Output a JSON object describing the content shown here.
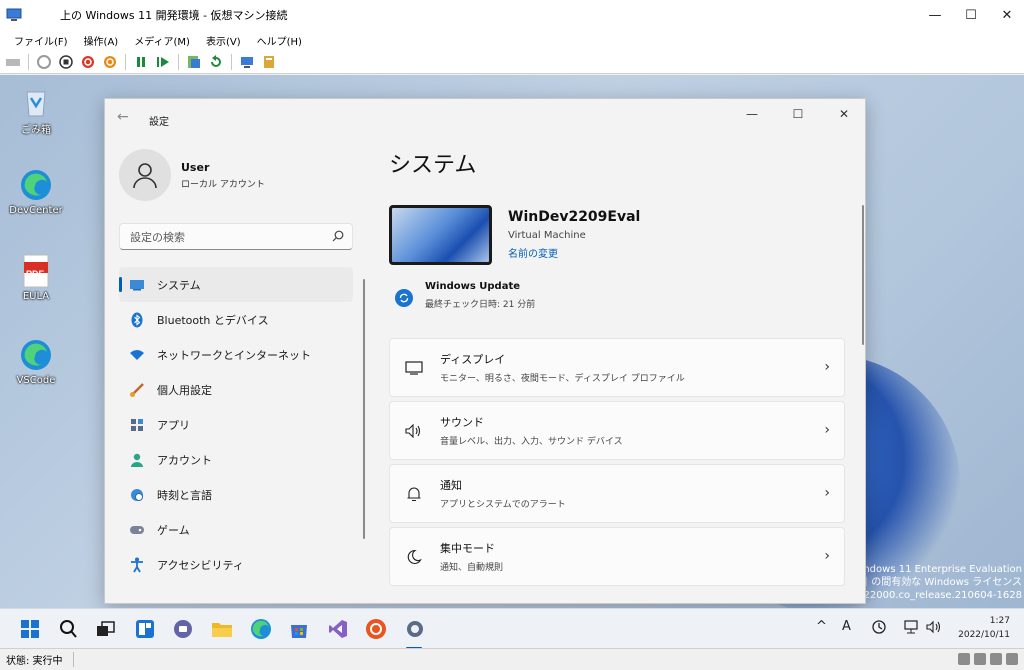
{
  "host": {
    "title": "上の Windows 11 開発環境 - 仮想マシン接続",
    "menu": [
      "ファイル(F)",
      "操作(A)",
      "メディア(M)",
      "表示(V)",
      "ヘルプ(H)"
    ],
    "status": "状態: 実行中"
  },
  "desktop": {
    "icons": [
      {
        "label": "ごみ箱",
        "icon": "recycle-bin-icon"
      },
      {
        "label": "DevCenter",
        "icon": "edge-icon"
      },
      {
        "label": "EULA",
        "icon": "pdf-icon"
      },
      {
        "label": "VSCode",
        "icon": "edge-icon"
      }
    ],
    "watermark": [
      "Windows 11 Enterprise Evaluation",
      "日 の間有効な Windows ライセンス",
      "uild 22000.co_release.210604-1628"
    ],
    "pdf_badge": "PDF"
  },
  "settings": {
    "title": "設定",
    "user": {
      "name": "User",
      "type": "ローカル アカウント"
    },
    "search_placeholder": "設定の検索",
    "nav": [
      {
        "label": "システム",
        "icon": "monitor-icon",
        "active": true
      },
      {
        "label": "Bluetooth とデバイス",
        "icon": "bluetooth-icon"
      },
      {
        "label": "ネットワークとインターネット",
        "icon": "wifi-icon"
      },
      {
        "label": "個人用設定",
        "icon": "brush-icon"
      },
      {
        "label": "アプリ",
        "icon": "apps-icon"
      },
      {
        "label": "アカウント",
        "icon": "person-icon"
      },
      {
        "label": "時刻と言語",
        "icon": "globe-clock-icon"
      },
      {
        "label": "ゲーム",
        "icon": "gamepad-icon"
      },
      {
        "label": "アクセシビリティ",
        "icon": "accessibility-icon"
      }
    ],
    "main_title": "システム",
    "device": {
      "name": "WinDev2209Eval",
      "type": "Virtual Machine",
      "rename": "名前の変更"
    },
    "windows_update": {
      "title": "Windows Update",
      "sub": "最終チェック日時: 21 分前"
    },
    "cards": [
      {
        "title": "ディスプレイ",
        "sub": "モニター、明るさ、夜間モード、ディスプレイ プロファイル",
        "icon": "display-icon"
      },
      {
        "title": "サウンド",
        "sub": "音量レベル、出力、入力、サウンド デバイス",
        "icon": "speaker-icon"
      },
      {
        "title": "通知",
        "sub": "アプリとシステムでのアラート",
        "icon": "bell-icon"
      },
      {
        "title": "集中モード",
        "sub": "通知、自動規則",
        "icon": "moon-icon"
      }
    ]
  },
  "taskbar": {
    "ime": "A",
    "time": "1:27",
    "date": "2022/10/11"
  },
  "colors": {
    "accent": "#005fb8",
    "desktop": "#b2c6dc"
  }
}
